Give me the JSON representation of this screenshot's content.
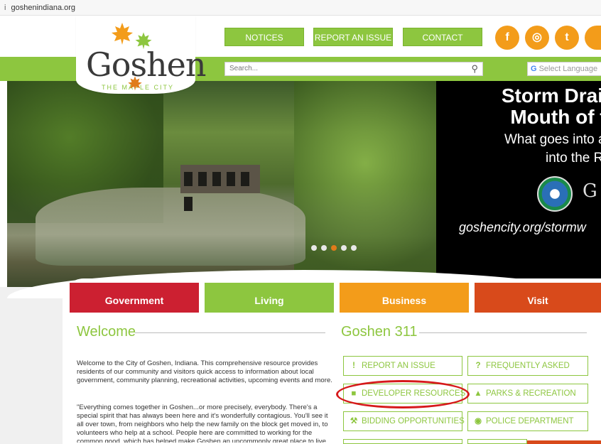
{
  "browser": {
    "url": "goshenindiana.org"
  },
  "logo": {
    "name": "Goshen",
    "tagline": "THE MAPLE CITY"
  },
  "top_nav": {
    "notices": "NOTICES",
    "report": "REPORT AN ISSUE",
    "contact": "CONTACT"
  },
  "social": {
    "facebook": "f",
    "instagram": "◎",
    "twitter": "t",
    "youtube": "▶"
  },
  "search": {
    "placeholder": "Search..."
  },
  "language": {
    "label": "Select Language"
  },
  "hero": {
    "title_line1": "Storm Drain",
    "title_line2": "Mouth of t",
    "line1": "What goes into a",
    "line2": "into the R",
    "seal_letter": "G",
    "url": "goshencity.org/stormw",
    "slides": 5,
    "active_slide": 3
  },
  "tabs": {
    "government": "Government",
    "living": "Living",
    "business": "Business",
    "visit": "Visit"
  },
  "welcome": {
    "title": "Welcome",
    "p1": "Welcome to the City of Goshen, Indiana. This comprehensive resource provides residents of our community and visitors quick access to information about local government, community planning, recreational activities, upcoming events and more.",
    "p2": "\"Everything comes together in Goshen...or more precisely, everybody. There's a special spirit that has always been here and it's wonderfully contagious. You'll see it all over town, from neighbors who help the new family on the block get moved in, to volunteers who help at a school.  People here are committed to working for the common good, which has helped make Goshen an uncommonly great place to live"
  },
  "goshen311": {
    "title": "Goshen 311",
    "report": "REPORT AN ISSUE",
    "faq": "FREQUENTLY ASKED",
    "developer": "DEVELOPER RESOURCES",
    "parks": "PARKS & RECREATION",
    "bidding": "BIDDING OPPORTUNITIES",
    "police": "POLICE DEPARTMENT"
  },
  "colors": {
    "green": "#8dc63f",
    "orange": "#f39c1a",
    "gov_red": "#cc2031",
    "business_orange": "#f39c1a",
    "visit_orange": "#d84a1b",
    "highlight_red": "#d6191b"
  }
}
